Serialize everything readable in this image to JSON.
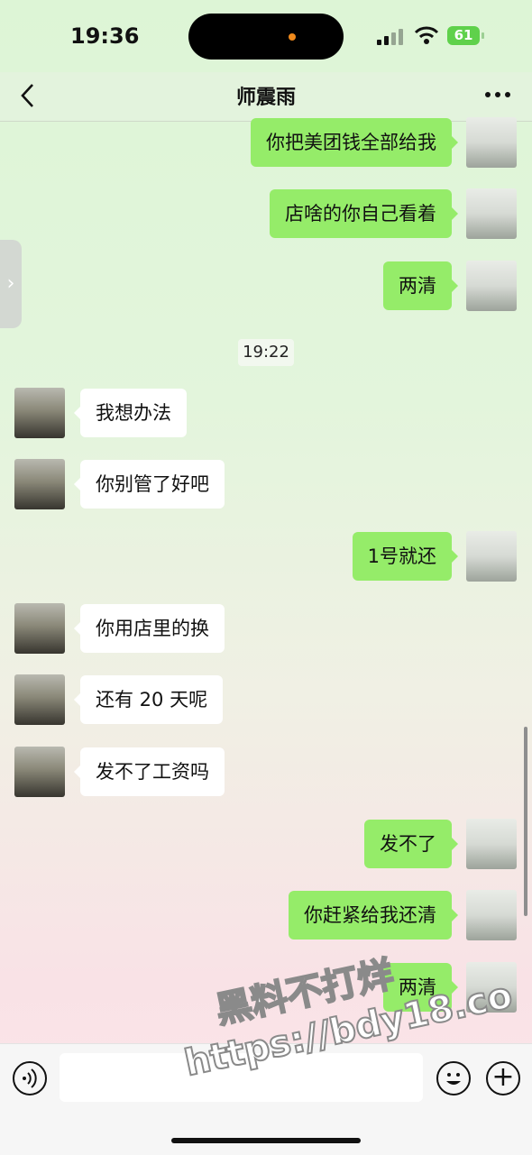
{
  "status_bar": {
    "time": "19:36",
    "battery": "61"
  },
  "nav": {
    "title": "师震雨",
    "back_icon": "chevron-left-icon",
    "more_icon": "more-dots-icon"
  },
  "messages": [
    {
      "sender": "me",
      "text": "你把美团钱全部给我"
    },
    {
      "sender": "me",
      "text": "店啥的你自己看着"
    },
    {
      "sender": "me",
      "text": "两清"
    },
    {
      "type": "time",
      "text": "19:22"
    },
    {
      "sender": "other",
      "text": "我想办法"
    },
    {
      "sender": "other",
      "text": "你别管了好吧"
    },
    {
      "sender": "me",
      "text": "1号就还"
    },
    {
      "sender": "other",
      "text": "你用店里的换"
    },
    {
      "sender": "other",
      "text": "还有 20 天呢"
    },
    {
      "sender": "other",
      "text": "发不了工资吗"
    },
    {
      "sender": "me",
      "text": "发不了"
    },
    {
      "sender": "me",
      "text": "你赶紧给我还清"
    },
    {
      "sender": "me",
      "text": "两清"
    }
  ],
  "watermark": {
    "line1": "黑料不打烊",
    "line2": "https://bdy18.co"
  },
  "colors": {
    "my_bubble": "#95ec69",
    "other_bubble": "#ffffff"
  },
  "input": {
    "placeholder": ""
  }
}
